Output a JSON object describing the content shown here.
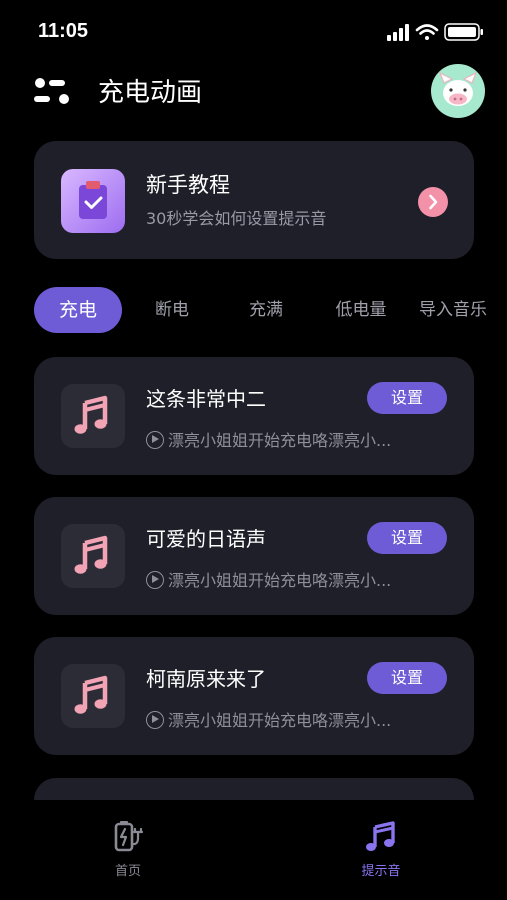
{
  "status_bar": {
    "time": "11:05"
  },
  "header": {
    "title": "充电动画"
  },
  "tutorial": {
    "title": "新手教程",
    "subtitle": "30秒学会如何设置提示音"
  },
  "tabs": [
    {
      "label": "充电",
      "active": true
    },
    {
      "label": "断电",
      "active": false
    },
    {
      "label": "充满",
      "active": false
    },
    {
      "label": "低电量",
      "active": false
    },
    {
      "label": "导入音乐",
      "active": false
    }
  ],
  "sounds": [
    {
      "name": "这条非常中二",
      "desc": "漂亮小姐姐开始充电咯漂亮小...",
      "action": "设置"
    },
    {
      "name": "可爱的日语声",
      "desc": "漂亮小姐姐开始充电咯漂亮小...",
      "action": "设置"
    },
    {
      "name": "柯南原来来了",
      "desc": "漂亮小姐姐开始充电咯漂亮小...",
      "action": "设置"
    }
  ],
  "bottom_nav": [
    {
      "label": "首页",
      "active": false,
      "icon": "battery-charging-icon"
    },
    {
      "label": "提示音",
      "active": true,
      "icon": "music-note-icon"
    }
  ],
  "colors": {
    "accent": "#6e5bd6",
    "card": "#1f1f29",
    "nav_active": "#8b74f0",
    "arrow": "#f291a8"
  }
}
